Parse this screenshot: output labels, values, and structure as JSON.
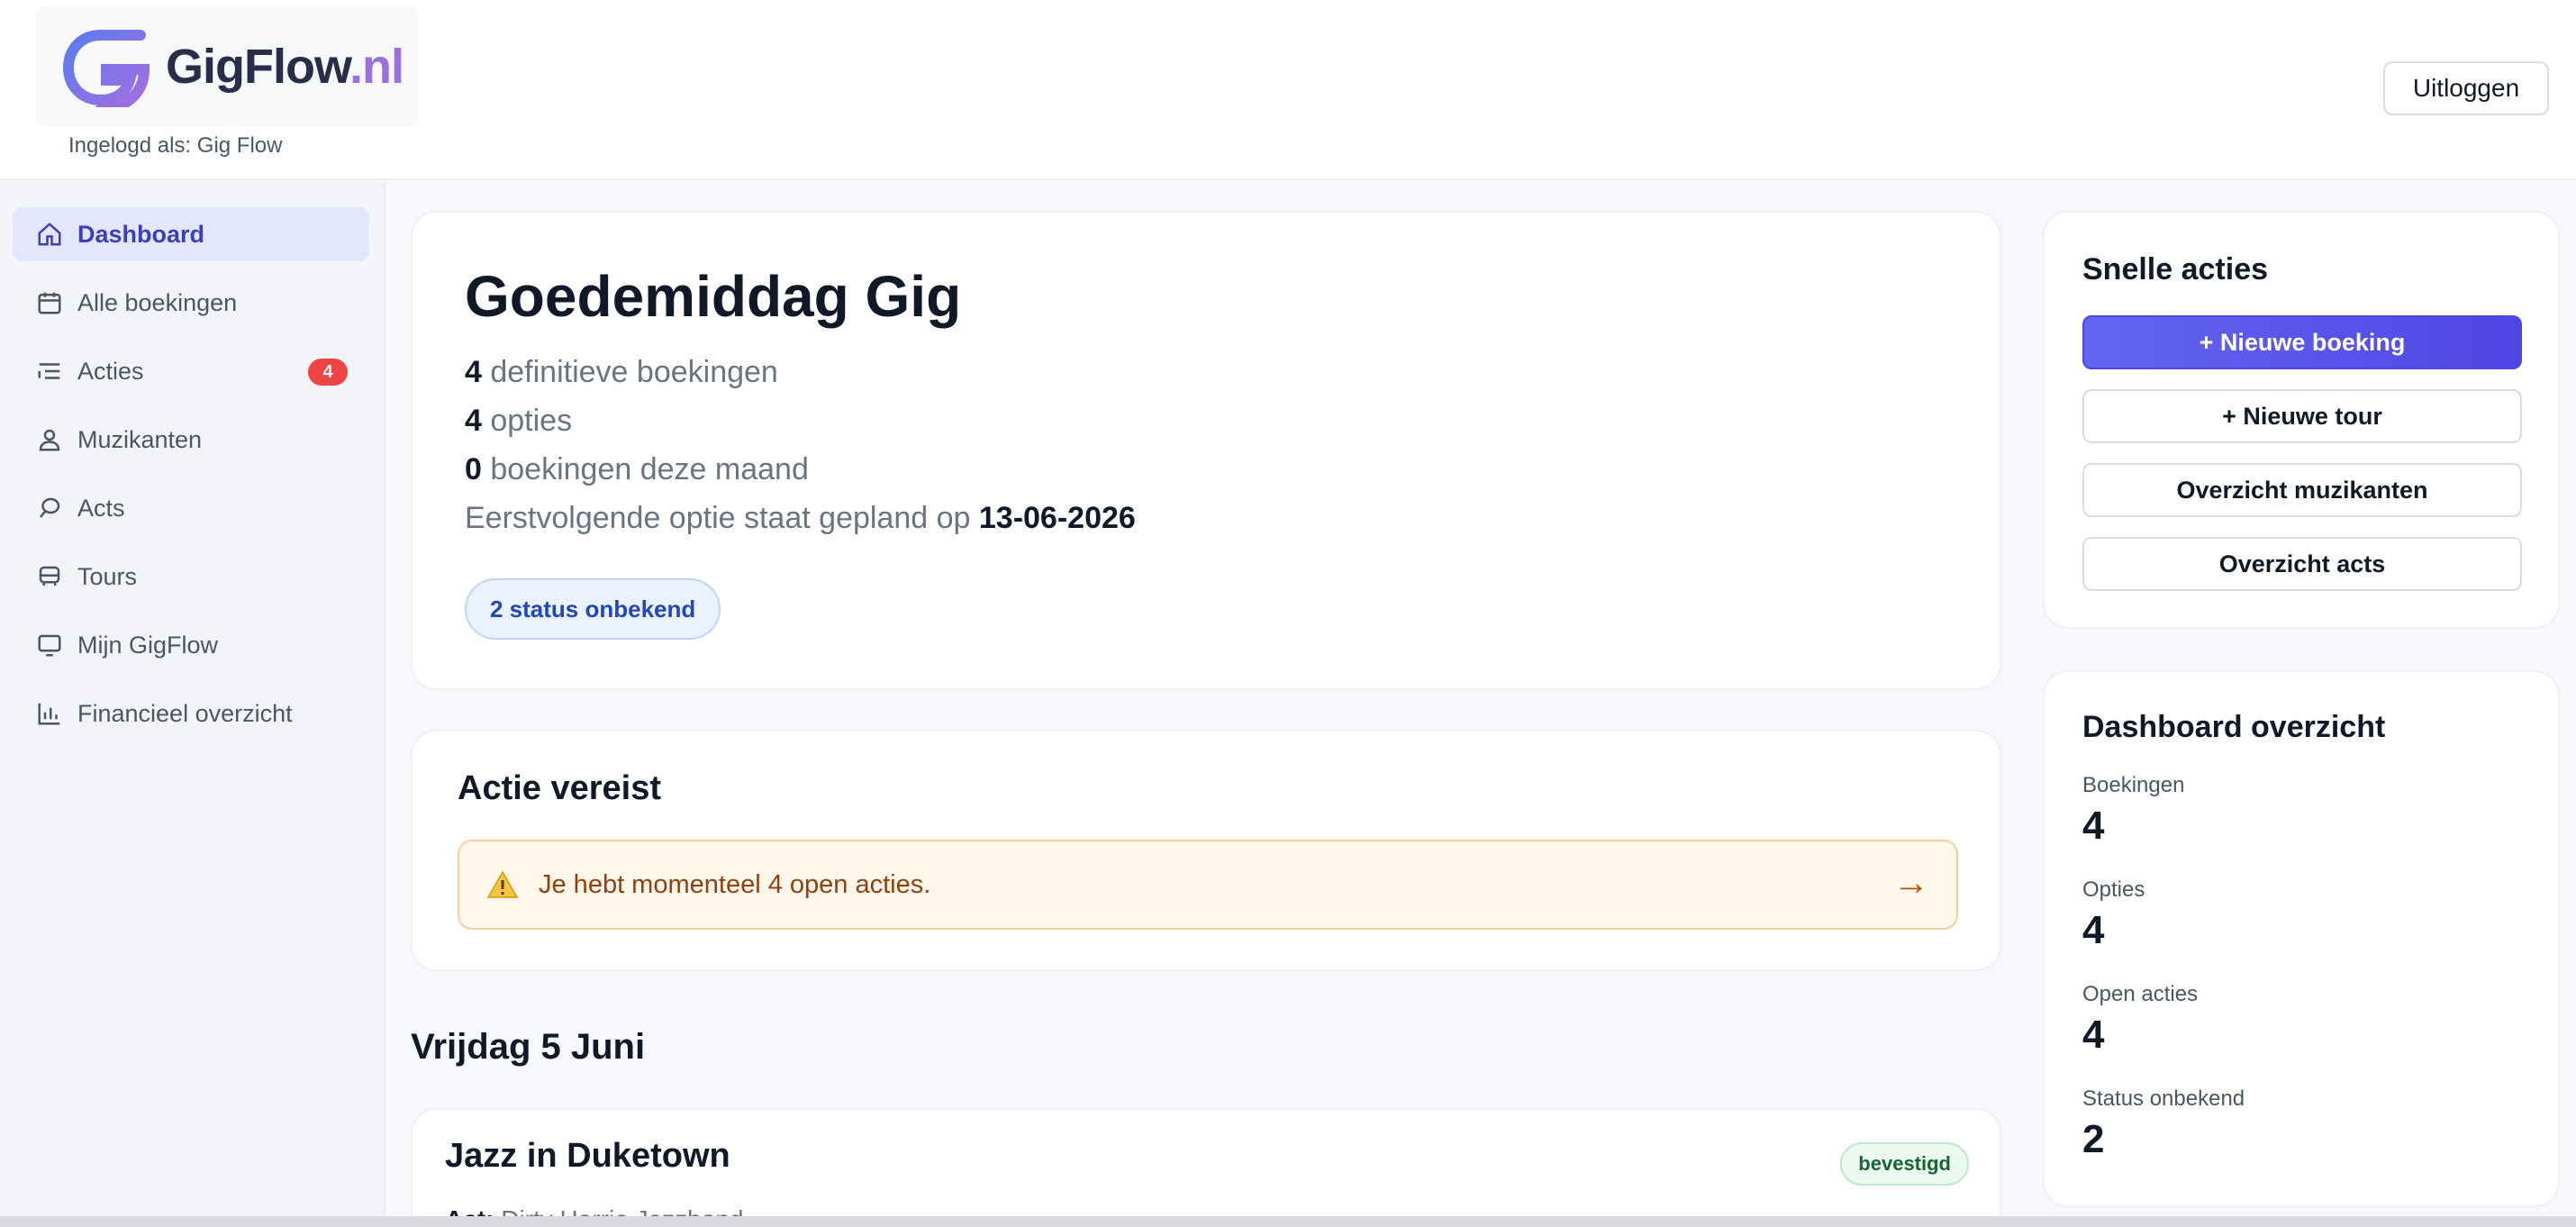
{
  "header": {
    "logo_main": "GigFlow",
    "logo_tld": ".nl",
    "logged_in": "Ingelogd als: Gig Flow",
    "logout_label": "Uitloggen"
  },
  "sidebar": {
    "items": [
      {
        "label": "Dashboard",
        "icon": "home-icon",
        "active": true
      },
      {
        "label": "Alle boekingen",
        "icon": "calendar-icon"
      },
      {
        "label": "Acties",
        "icon": "list-icon",
        "badge": "4"
      },
      {
        "label": "Muzikanten",
        "icon": "user-icon"
      },
      {
        "label": "Acts",
        "icon": "microphone-icon"
      },
      {
        "label": "Tours",
        "icon": "bus-icon"
      },
      {
        "label": "Mijn GigFlow",
        "icon": "monitor-icon"
      },
      {
        "label": "Financieel overzicht",
        "icon": "bar-chart-icon"
      }
    ]
  },
  "greeting": {
    "title": "Goedemiddag Gig",
    "definitive_count": "4",
    "definitive_text": " definitieve boekingen",
    "options_count": "4",
    "options_text": " opties",
    "month_count": "0",
    "month_text": " boekingen deze maand",
    "next_option_text": "Eerstvolgende optie staat gepland op ",
    "next_option_date": "13-06-2026",
    "status_pill": "2 status onbekend"
  },
  "action_required": {
    "title": "Actie vereist",
    "alert_text": "Je hebt momenteel 4 open acties.",
    "arrow": "→"
  },
  "day": {
    "title": "Vrijdag 5 Juni"
  },
  "event": {
    "title": "Jazz in Duketown",
    "status": "bevestigd",
    "act_label": "Act:",
    "act_value": " Dirty Harrie Jazzband"
  },
  "quick_actions": {
    "title": "Snelle acties",
    "new_booking": "+ Nieuwe boeking",
    "new_tour": "+ Nieuwe tour",
    "musicians_overview": "Overzicht muzikanten",
    "acts_overview": "Overzicht acts"
  },
  "overview": {
    "title": "Dashboard overzicht",
    "items": [
      {
        "label": "Boekingen",
        "value": "4"
      },
      {
        "label": "Opties",
        "value": "4"
      },
      {
        "label": "Open acties",
        "value": "4"
      },
      {
        "label": "Status onbekend",
        "value": "2"
      }
    ]
  },
  "colors": {
    "accent": "#4f46e5",
    "active_nav_bg": "#e4e6fb",
    "badge_red": "#ef4444",
    "alert_bg": "#fff6ec",
    "success_text": "#166534"
  }
}
